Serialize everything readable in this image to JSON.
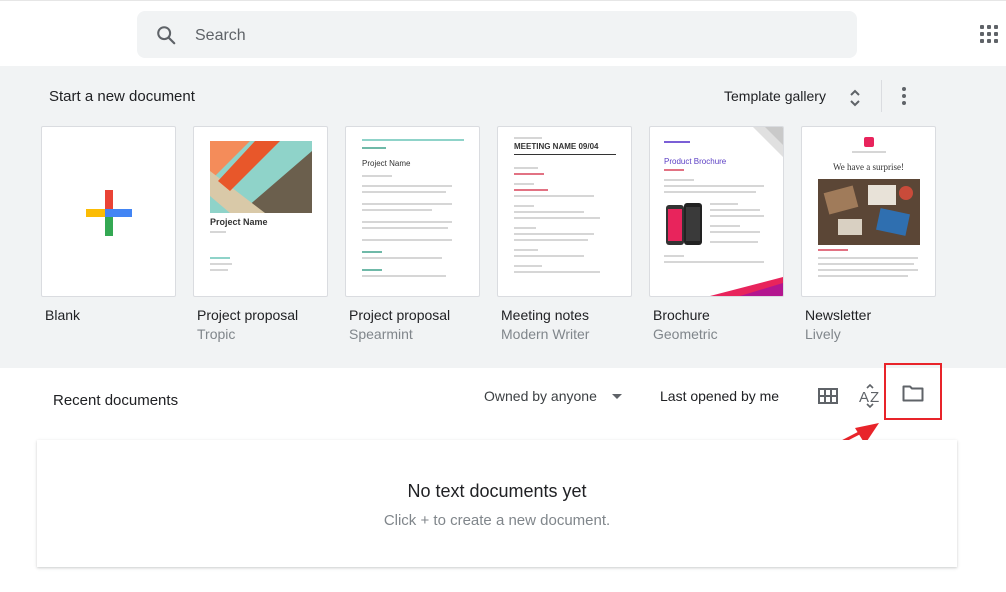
{
  "search": {
    "placeholder": "Search"
  },
  "templates": {
    "title": "Start a new document",
    "gallery_label": "Template gallery",
    "items": [
      {
        "name": "Blank",
        "subtitle": ""
      },
      {
        "name": "Project proposal",
        "subtitle": "Tropic",
        "thumb_text": "Project Name"
      },
      {
        "name": "Project proposal",
        "subtitle": "Spearmint",
        "thumb_text": "Project Name"
      },
      {
        "name": "Meeting notes",
        "subtitle": "Modern Writer",
        "thumb_text": "MEETING NAME 09/04"
      },
      {
        "name": "Brochure",
        "subtitle": "Geometric",
        "thumb_text": "Product Brochure"
      },
      {
        "name": "Newsletter",
        "subtitle": "Lively",
        "thumb_text": "We have a surprise!"
      }
    ]
  },
  "recent": {
    "title": "Recent documents",
    "owner_filter": "Owned by anyone",
    "sort_label": "Last opened by me",
    "empty_title": "No text documents yet",
    "empty_subtitle": "Click + to create a new document."
  },
  "colors": {
    "annotation": "#e8242a",
    "panel_bg": "#f1f3f4"
  },
  "icons": [
    "search-icon",
    "apps-grid-icon",
    "unfold-icon",
    "more-vert-icon",
    "grid-view-icon",
    "sort-az-icon",
    "folder-icon"
  ]
}
